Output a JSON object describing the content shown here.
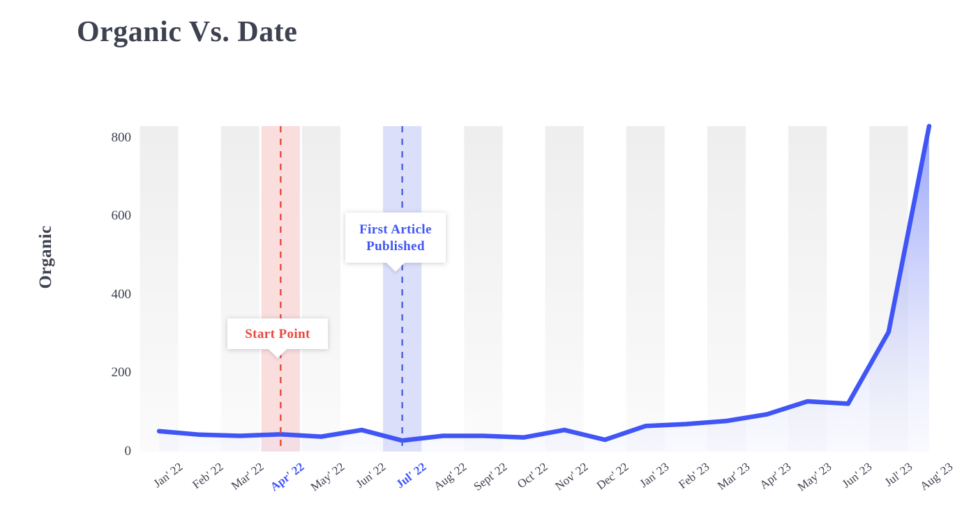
{
  "title": "Organic Vs. Date",
  "y_axis_title": "Organic",
  "annotations": [
    {
      "id": "start-point",
      "text": "Start Point",
      "color": "#e8483d",
      "at_category": "Apr' 22"
    },
    {
      "id": "first-article-published",
      "line1": "First  Article",
      "line2": "Published",
      "color": "#4055f5",
      "at_category": "Jul' 22"
    }
  ],
  "chart_data": {
    "type": "area",
    "title": "Organic Vs. Date",
    "xlabel": "",
    "ylabel": "Organic",
    "ylim": [
      0,
      830
    ],
    "yticks": [
      0,
      200,
      400,
      600,
      800
    ],
    "grid": false,
    "legend": "none",
    "line_color": "#4055f5",
    "fill_color": "#8e9cf7",
    "band_color": "#f0f0f0",
    "highlight_categories": [
      "Apr' 22",
      "Jul' 22"
    ],
    "categories": [
      "Jan' 22",
      "Feb' 22",
      "Mar' 22",
      "Apr' 22",
      "May' 22",
      "Jun' 22",
      "Jul' 22",
      "Aug' 22",
      "Sept' 22",
      "Oct' 22",
      "Nov' 22",
      "Dec' 22",
      "Jan' 23",
      "Feb' 23",
      "Mar' 23",
      "Apr' 23",
      "May' 23",
      "Jun' 23",
      "Jul' 23",
      "Aug' 23"
    ],
    "values": [
      52,
      43,
      40,
      44,
      38,
      55,
      28,
      40,
      40,
      36,
      55,
      30,
      65,
      70,
      78,
      95,
      128,
      122,
      305,
      830
    ],
    "vertical_markers": [
      {
        "category": "Apr' 22",
        "color": "#e8483d",
        "band_color": "#fadddd",
        "style": "dashed",
        "label": "Start Point"
      },
      {
        "category": "Jul' 22",
        "color": "#4a63d8",
        "band_color": "#dcdffa",
        "style": "dashed",
        "label": "First Article Published"
      }
    ]
  }
}
